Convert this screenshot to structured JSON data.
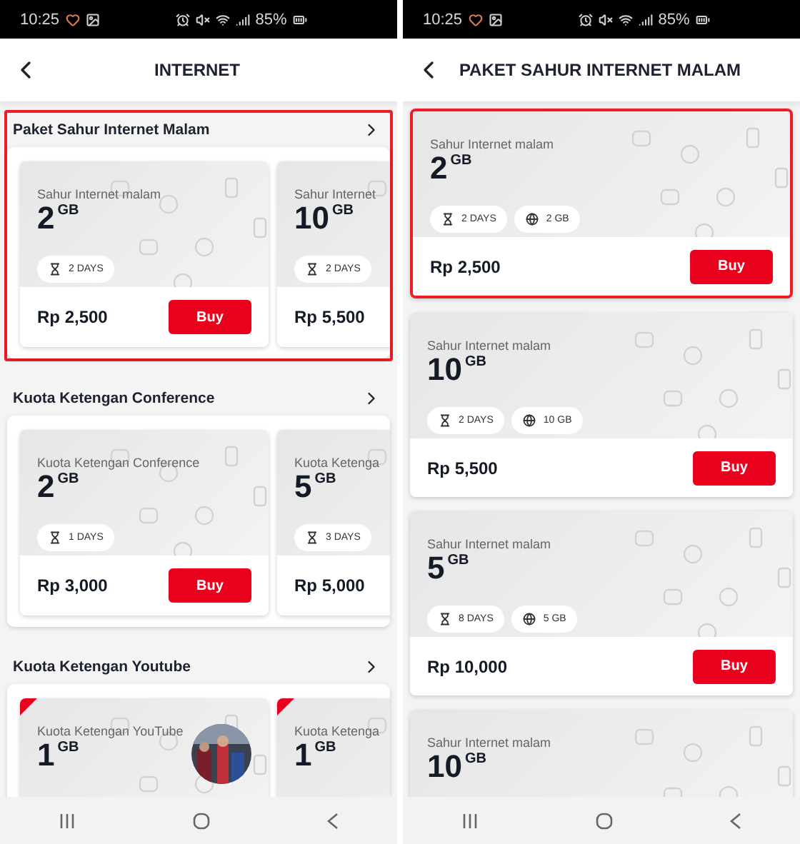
{
  "screens": [
    {
      "kind": "category_list",
      "status_bar": {
        "time": "10:25",
        "battery": "85%"
      },
      "header": {
        "title": "INTERNET"
      },
      "sections": [
        {
          "title": "Paket Sahur Internet Malam",
          "highlighted": true,
          "packages": [
            {
              "name": "Sahur Internet malam",
              "amount": "2",
              "unit": "GB",
              "flagged": false,
              "chips": [
                {
                  "kind": "duration",
                  "label": "2 DAYS"
                }
              ],
              "price": "Rp 2,500",
              "button": "Buy"
            },
            {
              "name": "Sahur Internet",
              "amount": "10",
              "unit": "GB",
              "flagged": false,
              "chips": [
                {
                  "kind": "duration",
                  "label": "2 DAYS"
                }
              ],
              "price": "Rp 5,500"
            }
          ]
        },
        {
          "title": "Kuota Ketengan Conference",
          "highlighted": false,
          "packages": [
            {
              "name": "Kuota Ketengan Conference",
              "amount": "2",
              "unit": "GB",
              "flagged": false,
              "chips": [
                {
                  "kind": "duration",
                  "label": "1 DAYS"
                }
              ],
              "price": "Rp 3,000",
              "button": "Buy"
            },
            {
              "name": "Kuota Ketenga",
              "amount": "5",
              "unit": "GB",
              "flagged": false,
              "chips": [
                {
                  "kind": "duration",
                  "label": "3 DAYS"
                }
              ],
              "price": "Rp 5,000"
            }
          ]
        },
        {
          "title": "Kuota Ketengan Youtube",
          "highlighted": false,
          "packages": [
            {
              "name": "Kuota Ketengan YouTube",
              "amount": "1",
              "unit": "GB",
              "flagged": true
            },
            {
              "name": "Kuota Ketenga",
              "amount": "1",
              "unit": "GB",
              "flagged": true
            }
          ]
        }
      ]
    },
    {
      "kind": "package_list",
      "status_bar": {
        "time": "10:25",
        "battery": "85%"
      },
      "header": {
        "title": "PAKET SAHUR INTERNET MALAM"
      },
      "packages": [
        {
          "name": "Sahur Internet malam",
          "amount": "2",
          "unit": "GB",
          "highlighted": true,
          "chips": [
            {
              "kind": "duration",
              "label": "2 DAYS"
            },
            {
              "kind": "data",
              "label": "2 GB"
            }
          ],
          "price": "Rp 2,500",
          "button": "Buy"
        },
        {
          "name": "Sahur Internet malam",
          "amount": "10",
          "unit": "GB",
          "highlighted": false,
          "chips": [
            {
              "kind": "duration",
              "label": "2 DAYS"
            },
            {
              "kind": "data",
              "label": "10 GB"
            }
          ],
          "price": "Rp 5,500",
          "button": "Buy"
        },
        {
          "name": "Sahur Internet malam",
          "amount": "5",
          "unit": "GB",
          "highlighted": false,
          "chips": [
            {
              "kind": "duration",
              "label": "8 DAYS"
            },
            {
              "kind": "data",
              "label": "5 GB"
            }
          ],
          "price": "Rp 10,000",
          "button": "Buy"
        },
        {
          "name": "Sahur Internet malam",
          "amount": "10",
          "unit": "GB",
          "highlighted": false
        }
      ]
    }
  ]
}
